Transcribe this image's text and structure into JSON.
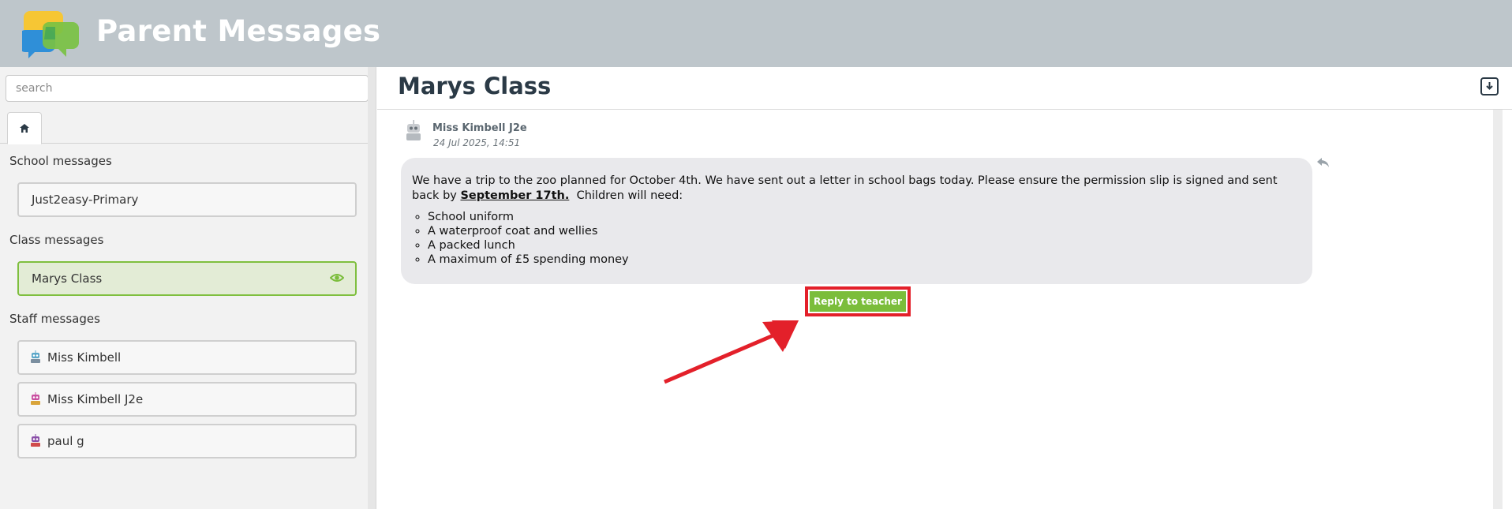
{
  "header": {
    "title": "Parent Messages"
  },
  "sidebar": {
    "search_placeholder": "search",
    "sections": {
      "school": {
        "heading": "School messages",
        "items": [
          "Just2easy-Primary"
        ]
      },
      "class": {
        "heading": "Class messages",
        "items": [
          "Marys Class"
        ]
      },
      "staff": {
        "heading": "Staff messages",
        "items": [
          "Miss Kimbell",
          "Miss Kimbell J2e",
          "paul g"
        ]
      }
    }
  },
  "main": {
    "title": "Marys Class",
    "message": {
      "author": "Miss Kimbell J2e",
      "date": "24 Jul 2025, 14:51",
      "text_before": "We have a trip to the zoo planned for October 4th. We have sent out a letter in school bags today. Please ensure the permission slip is signed and sent back by ",
      "text_bold": "September 17th.",
      "text_after": "  Children will need:",
      "list": [
        "School uniform",
        "A waterproof coat and wellies",
        "A packed lunch",
        "A maximum of £5 spending money"
      ]
    },
    "reply_button": "Reply to teacher"
  },
  "colors": {
    "header_bg": "#bec6cb",
    "accent_green": "#7bbd3b",
    "highlight_red": "#e3202a",
    "title_dark": "#2b3a46"
  }
}
